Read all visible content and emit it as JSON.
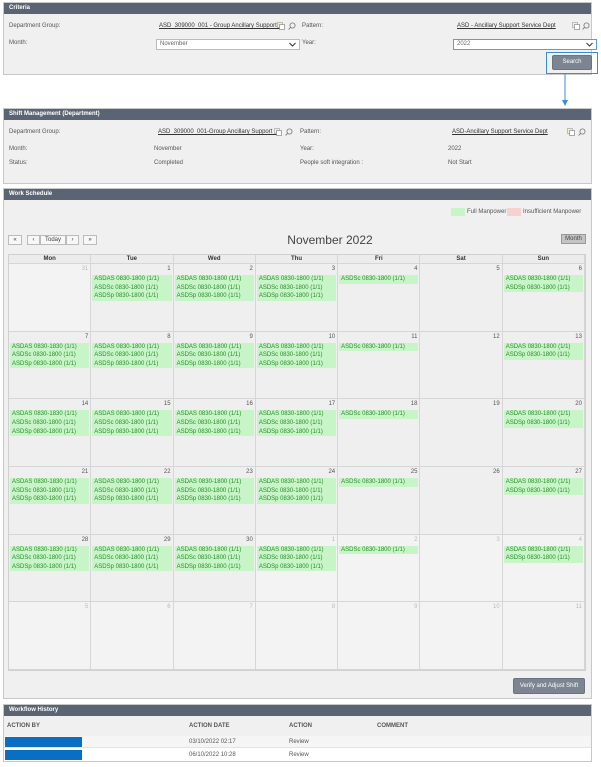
{
  "criteria": {
    "header": "Criteria",
    "dept_group_label": "Department Group:",
    "dept_group_value": "ASD_309000_001 - Group Ancillary Support S",
    "pattern_label": "Pattern:",
    "pattern_value": "ASD - Ancillary Support Service Dept",
    "month_label": "Month:",
    "month_value": "November",
    "year_label": "Year:",
    "year_value": "2022",
    "search_label": "Search"
  },
  "shift": {
    "header": "Shift Management (Department)",
    "dept_group_label": "Department Group:",
    "dept_group_value": "ASD_309000_001-Group Ancillary Support S",
    "pattern_label": "Pattern:",
    "pattern_value": "ASD-Ancillary Support Service Dept",
    "month_label": "Month:",
    "month_value": "November",
    "year_label": "Year:",
    "year_value": "2022",
    "status_label": "Status:",
    "status_value": "Completed",
    "ps_label": "People soft integration :",
    "ps_value": "Not Start"
  },
  "schedule": {
    "header": "Work Schedule",
    "legend_full": "Full Manpower",
    "legend_insufficient": "Insufficient Manpower",
    "color_full": "#c8f5c8",
    "color_insufficient": "#f7d0d0",
    "nav_prev_year": "«",
    "nav_prev": "‹",
    "today_label": "Today",
    "nav_next": "›",
    "nav_next_year": "»",
    "title": "November 2022",
    "month_btn": "Month",
    "day_headers": [
      "Mon",
      "Tue",
      "Wed",
      "Thu",
      "Fri",
      "Sat",
      "Sun"
    ],
    "weeks": [
      [
        {
          "day": "31",
          "other": true,
          "events": []
        },
        {
          "day": "1",
          "events": [
            "ASDAS 0830-1800 (1/1)",
            "ASDSc 0830-1800 (1/1)",
            "ASDSp 0830-1800 (1/1)"
          ]
        },
        {
          "day": "2",
          "events": [
            "ASDAS 0830-1800 (1/1)",
            "ASDSc 0830-1800 (1/1)",
            "ASDSp 0830-1800 (1/1)"
          ]
        },
        {
          "day": "3",
          "events": [
            "ASDAS 0830-1800 (1/1)",
            "ASDSc 0830-1800 (1/1)",
            "ASDSp 0830-1800 (1/1)"
          ]
        },
        {
          "day": "4",
          "events": [
            "ASDSc 0830-1800 (1/1)"
          ]
        },
        {
          "day": "5",
          "events": []
        },
        {
          "day": "6",
          "events": [
            "ASDAS 0830-1800 (1/1)",
            "ASDSp 0830-1800 (1/1)"
          ]
        }
      ],
      [
        {
          "day": "7",
          "events": [
            "ASDAS 0830-1830 (1/1)",
            "ASDSc 0830-1800 (1/1)",
            "ASDSp 0830-1800 (1/1)"
          ]
        },
        {
          "day": "8",
          "events": [
            "ASDAS 0830-1800 (1/1)",
            "ASDSc 0830-1800 (1/1)",
            "ASDSp 0830-1800 (1/1)"
          ]
        },
        {
          "day": "9",
          "events": [
            "ASDAS 0830-1800 (1/1)",
            "ASDSc 0830-1800 (1/1)",
            "ASDSp 0830-1800 (1/1)"
          ]
        },
        {
          "day": "10",
          "events": [
            "ASDAS 0830-1800 (1/1)",
            "ASDSc 0830-1800 (1/1)",
            "ASDSp 0830-1800 (1/1)"
          ]
        },
        {
          "day": "11",
          "events": [
            "ASDSc 0830-1800 (1/1)"
          ]
        },
        {
          "day": "12",
          "events": []
        },
        {
          "day": "13",
          "events": [
            "ASDAS 0830-1800 (1/1)",
            "ASDSp 0830-1800 (1/1)"
          ]
        }
      ],
      [
        {
          "day": "14",
          "events": [
            "ASDAS 0830-1830 (1/1)",
            "ASDSc 0830-1800 (1/1)",
            "ASDSp 0830-1800 (1/1)"
          ]
        },
        {
          "day": "15",
          "events": [
            "ASDAS 0830-1800 (1/1)",
            "ASDSc 0830-1800 (1/1)",
            "ASDSp 0830-1800 (1/1)"
          ]
        },
        {
          "day": "16",
          "events": [
            "ASDAS 0830-1800 (1/1)",
            "ASDSc 0830-1800 (1/1)",
            "ASDSp 0830-1800 (1/1)"
          ]
        },
        {
          "day": "17",
          "events": [
            "ASDAS 0830-1800 (1/1)",
            "ASDSc 0830-1800 (1/1)",
            "ASDSp 0830-1800 (1/1)"
          ]
        },
        {
          "day": "18",
          "events": [
            "ASDSc 0830-1800 (1/1)"
          ]
        },
        {
          "day": "19",
          "events": []
        },
        {
          "day": "20",
          "events": [
            "ASDAS 0830-1800 (1/1)",
            "ASDSp 0830-1800 (1/1)"
          ]
        }
      ],
      [
        {
          "day": "21",
          "events": [
            "ASDAS 0830-1830 (1/1)",
            "ASDSc 0830-1800 (1/1)",
            "ASDSp 0830-1800 (1/1)"
          ]
        },
        {
          "day": "22",
          "events": [
            "ASDAS 0830-1800 (1/1)",
            "ASDSc 0830-1800 (1/1)",
            "ASDSp 0830-1800 (1/1)"
          ]
        },
        {
          "day": "23",
          "events": [
            "ASDAS 0830-1800 (1/1)",
            "ASDSc 0830-1800 (1/1)",
            "ASDSp 0830-1800 (1/1)"
          ]
        },
        {
          "day": "24",
          "events": [
            "ASDAS 0830-1800 (1/1)",
            "ASDSc 0830-1800 (1/1)",
            "ASDSp 0830-1800 (1/1)"
          ]
        },
        {
          "day": "25",
          "events": [
            "ASDSc 0830-1800 (1/1)"
          ]
        },
        {
          "day": "26",
          "events": []
        },
        {
          "day": "27",
          "events": [
            "ASDAS 0830-1800 (1/1)",
            "ASDSp 0830-1800 (1/1)"
          ]
        }
      ],
      [
        {
          "day": "28",
          "events": [
            "ASDAS 0830-1830 (1/1)",
            "ASDSc 0830-1800 (1/1)",
            "ASDSp 0830-1800 (1/1)"
          ]
        },
        {
          "day": "29",
          "events": [
            "ASDAS 0830-1800 (1/1)",
            "ASDSc 0830-1800 (1/1)",
            "ASDSp 0830-1800 (1/1)"
          ]
        },
        {
          "day": "30",
          "events": [
            "ASDAS 0830-1800 (1/1)",
            "ASDSc 0830-1800 (1/1)",
            "ASDSp 0830-1800 (1/1)"
          ]
        },
        {
          "day": "1",
          "other": true,
          "events": [
            "ASDAS 0830-1800 (1/1)",
            "ASDSc 0830-1800 (1/1)",
            "ASDSp 0830-1800 (1/1)"
          ]
        },
        {
          "day": "2",
          "other": true,
          "events": [
            "ASDSc 0830-1800 (1/1)"
          ]
        },
        {
          "day": "3",
          "other": true,
          "events": []
        },
        {
          "day": "4",
          "other": true,
          "events": [
            "ASDAS 0830-1800 (1/1)",
            "ASDSp 0830-1800 (1/1)"
          ]
        }
      ],
      [
        {
          "day": "5",
          "other": true,
          "events": []
        },
        {
          "day": "6",
          "other": true,
          "events": []
        },
        {
          "day": "7",
          "other": true,
          "events": []
        },
        {
          "day": "8",
          "other": true,
          "events": []
        },
        {
          "day": "9",
          "other": true,
          "events": []
        },
        {
          "day": "10",
          "other": true,
          "events": []
        },
        {
          "day": "11",
          "other": true,
          "events": []
        }
      ]
    ],
    "verify_label": "Verify and Adjust Shift"
  },
  "workflow": {
    "header": "Workflow History",
    "columns": [
      "ACTION BY",
      "ACTION DATE",
      "ACTION",
      "COMMENT"
    ],
    "rows": [
      {
        "date": "03/10/2022 02:17",
        "action": "Review",
        "comment": ""
      },
      {
        "date": "06/10/2022 10:28",
        "action": "Review",
        "comment": ""
      }
    ],
    "redact_color": "#0a6fc2"
  }
}
